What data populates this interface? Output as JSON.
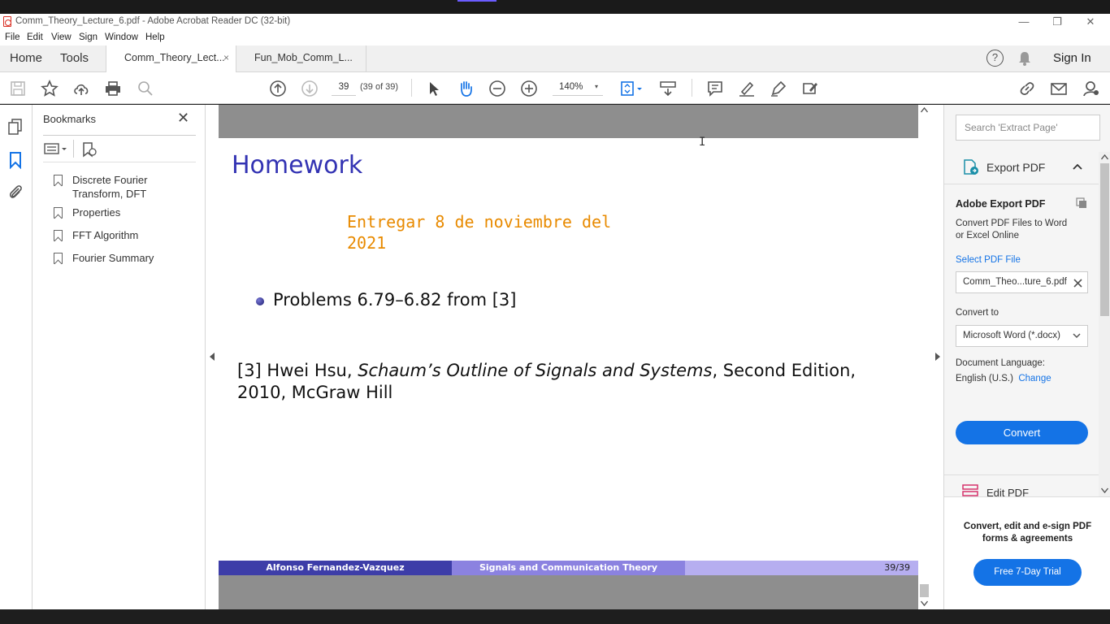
{
  "window": {
    "title": "Comm_Theory_Lecture_6.pdf - Adobe Acrobat Reader DC (32-bit)",
    "minimize": "—",
    "restore": "❐",
    "close": "✕"
  },
  "menu": [
    "File",
    "Edit",
    "View",
    "Sign",
    "Window",
    "Help"
  ],
  "nav_tabs": {
    "home": "Home",
    "tools": "Tools"
  },
  "doc_tabs": [
    {
      "label": "Comm_Theory_Lect...",
      "active": true,
      "close": "×"
    },
    {
      "label": "Fun_Mob_Comm_L...",
      "active": false
    }
  ],
  "account": {
    "sign_in": "Sign In",
    "help": "?"
  },
  "toolbar": {
    "page_current": "39",
    "page_count": "(39 of 39)",
    "zoom": "140%",
    "zoom_caret": "▾"
  },
  "bookmarks": {
    "header": "Bookmarks",
    "close": "✕",
    "items": [
      "Discrete Fourier Transform, DFT",
      "Properties",
      "FFT Algorithm",
      "Fourier Summary"
    ]
  },
  "slide": {
    "title": "Homework",
    "due_line1": "Entregar 8 de noviembre del",
    "due_line2": "2021",
    "problem": "Problems 6.79–6.82 from [3]",
    "ref_prefix": "[3] Hwei Hsu, ",
    "ref_italic": "Schaum’s Outline of Signals and Systems",
    "ref_suffix": ", Second Edition, 2010, McGraw Hill",
    "footer_author": "Alfonso Fernandez-Vazquez",
    "footer_course": "Signals and Communication Theory",
    "footer_page": "39/39"
  },
  "right_panel": {
    "search_placeholder": "Search 'Extract Page'",
    "export_title": "Export PDF",
    "adobe_export": "Adobe Export PDF",
    "desc": "Convert PDF Files to Word or Excel Online",
    "select_file": "Select PDF File",
    "file_name": "Comm_Theo...ture_6.pdf",
    "convert_to": "Convert to",
    "format": "Microsoft Word (*.docx)",
    "doc_lang": "Document Language:",
    "lang_value": "English (U.S.)",
    "change": "Change",
    "convert_btn": "Convert",
    "edit_pdf": "Edit PDF",
    "promo": "Convert, edit and e-sign PDF forms & agreements",
    "trial_btn": "Free 7-Day Trial"
  },
  "colors": {
    "accent": "#1473e6",
    "slide_title": "#3333b3",
    "due": "#e88a00",
    "footer1": "#3d3da8",
    "footer2": "#8b82e0",
    "footer3": "#b6aef0"
  }
}
